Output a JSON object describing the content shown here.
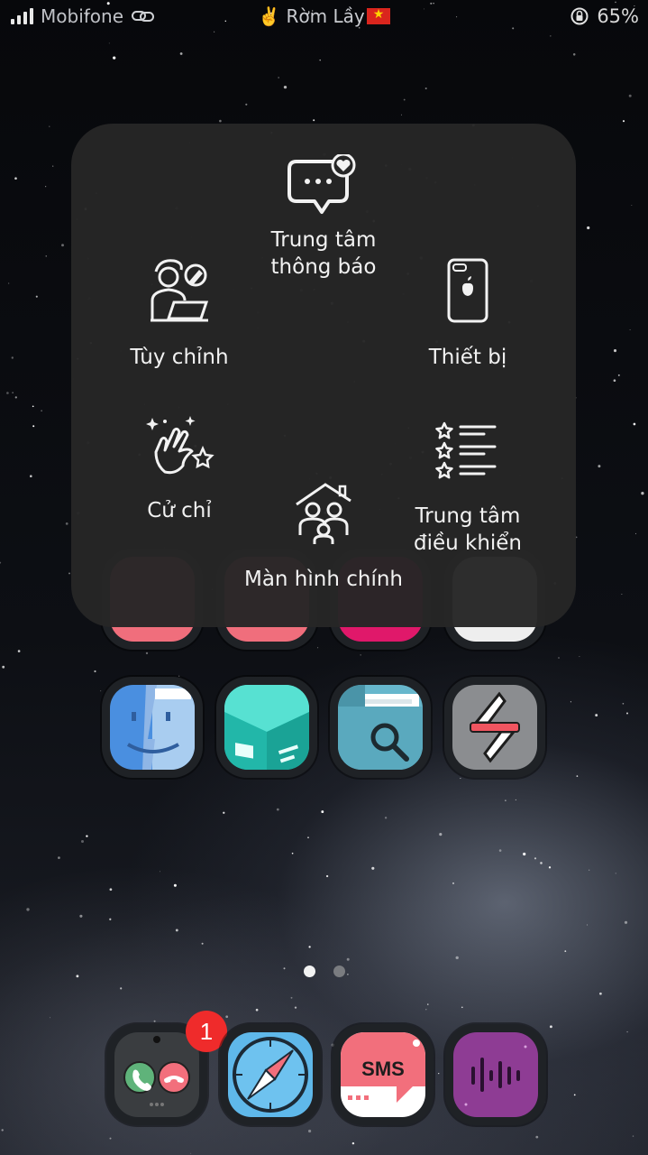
{
  "status_bar": {
    "carrier": "Mobifone",
    "owner_name": "✌️ Rờm Lầy",
    "battery": "65%"
  },
  "assistive_menu": {
    "items": [
      {
        "id": "notification_center",
        "label_line1": "Trung tâm",
        "label_line2": "thông báo",
        "icon": "chat-bubble-heart-icon"
      },
      {
        "id": "customize",
        "label": "Tùy chỉnh",
        "icon": "person-laptop-icon"
      },
      {
        "id": "device",
        "label": "Thiết bị",
        "icon": "iphone-icon"
      },
      {
        "id": "gestures",
        "label": "Cử chỉ",
        "icon": "sparkle-hand-icon"
      },
      {
        "id": "home",
        "label": "Màn hình chính",
        "icon": "family-home-icon"
      },
      {
        "id": "control_center",
        "label_line1": "Trung tâm",
        "label_line2": "điều khiển",
        "icon": "star-list-icon"
      }
    ]
  },
  "home_screen": {
    "row_apps": [
      "finder-icon",
      "box-app-icon",
      "files-search-icon",
      "s-logo-app-icon"
    ],
    "page_count": 2,
    "active_page": 1
  },
  "dock": {
    "apps": [
      "phone-icon",
      "safari-compass-icon",
      "sms-icon",
      "voice-memo-icon"
    ],
    "phone_badge": "1",
    "sms_label": "SMS"
  },
  "colors": {
    "panel_bg": "#262626",
    "badge_red": "#ef2b2b"
  }
}
